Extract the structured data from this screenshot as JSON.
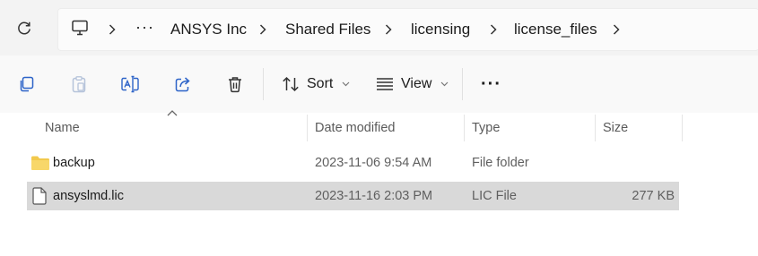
{
  "breadcrumb": {
    "overflow": "···",
    "items": [
      "ANSYS Inc",
      "Shared Files",
      "licensing",
      "license_files"
    ]
  },
  "toolbar": {
    "buttons": [
      "copy-icon",
      "paste-icon",
      "rename-icon",
      "share-icon",
      "delete-icon"
    ],
    "sort_label": "Sort",
    "view_label": "View",
    "more_label": "···"
  },
  "columns": {
    "name": "Name",
    "date": "Date modified",
    "type": "Type",
    "size": "Size"
  },
  "files": [
    {
      "name": "backup",
      "date": "2023-11-06 9:54 AM",
      "type": "File folder",
      "size": "",
      "icon": "folder-icon",
      "selected": false
    },
    {
      "name": "ansyslmd.lic",
      "date": "2023-11-16 2:03 PM",
      "type": "LIC File",
      "size": "277 KB",
      "icon": "file-icon",
      "selected": true
    }
  ],
  "colors": {
    "folder": "#f2c94c",
    "selected_row": "#d9d9d9",
    "accent": "#2c63c8"
  }
}
